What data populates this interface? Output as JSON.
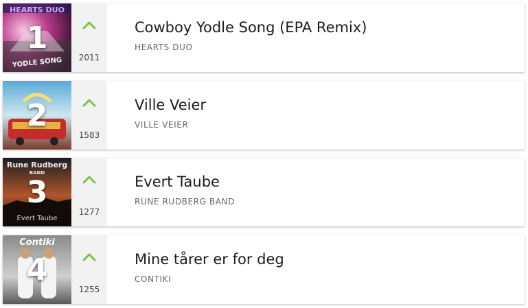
{
  "colors": {
    "trend_up": "#7cc242",
    "rank_text": "#ffffff",
    "title_text": "#1c1c1c",
    "artist_text": "#666666"
  },
  "songs": [
    {
      "rank": "1",
      "title": "Cowboy Yodle Song (EPA Remix)",
      "artist": "HEARTS DUO",
      "count": "2011",
      "trend": "up-chevron-icon",
      "cover_text": {
        "top": "HEARTS DUO",
        "bottom": "YODLE SONG"
      }
    },
    {
      "rank": "2",
      "title": "Ville Veier",
      "artist": "VILLE VEIER",
      "count": "1583",
      "trend": "up-chevron-icon"
    },
    {
      "rank": "3",
      "title": "Evert Taube",
      "artist": "RUNE RUDBERG BAND",
      "count": "1277",
      "trend": "up-chevron-icon",
      "cover_text": {
        "top": "Rune Rudberg",
        "sub": "BAND",
        "bottom": "Evert Taube"
      }
    },
    {
      "rank": "4",
      "title": "Mine tårer er for deg",
      "artist": "CONTIKI",
      "count": "1255",
      "trend": "up-chevron-icon",
      "cover_text": {
        "top": "Contiki"
      }
    }
  ]
}
